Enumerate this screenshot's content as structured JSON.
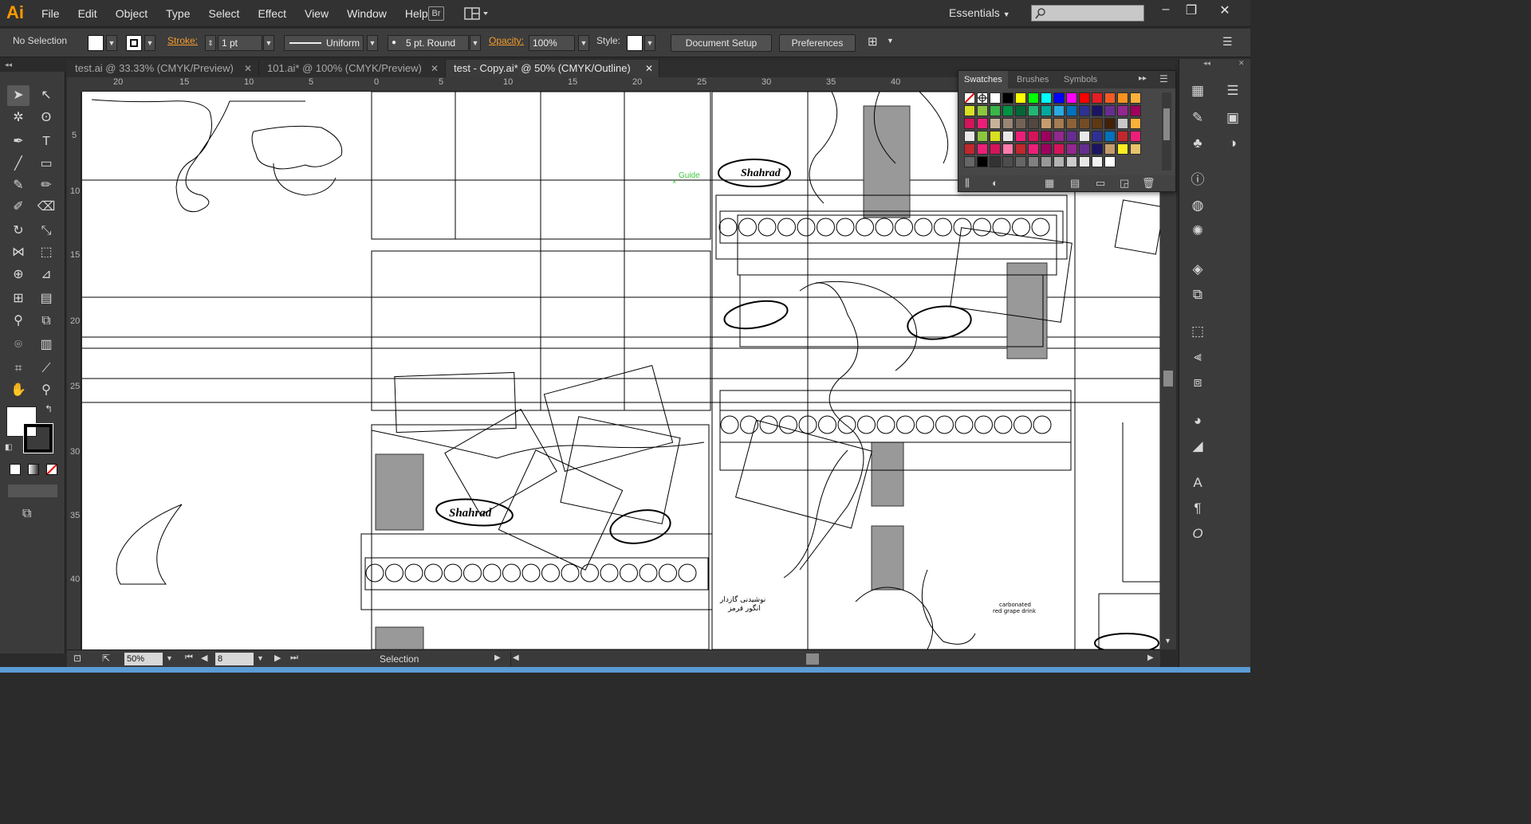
{
  "app": {
    "logo": "Ai",
    "menu": [
      "File",
      "Edit",
      "Object",
      "Type",
      "Select",
      "Effect",
      "View",
      "Window",
      "Help"
    ],
    "bridge_label": "Br",
    "workspace": "Essentials"
  },
  "control": {
    "selection": "No Selection",
    "stroke_label": "Stroke:",
    "stroke_value": "1 pt",
    "profile": "Uniform",
    "brush": "5 pt. Round",
    "opacity_label": "Opacity:",
    "opacity_value": "100%",
    "style_label": "Style:",
    "document_setup": "Document Setup",
    "preferences": "Preferences"
  },
  "tabs": [
    {
      "label": "test.ai @ 33.33% (CMYK/Preview)",
      "active": false
    },
    {
      "label": "101.ai* @ 100% (CMYK/Preview)",
      "active": false
    },
    {
      "label": "test - Copy.ai* @ 50% (CMYK/Outline)",
      "active": true
    }
  ],
  "ruler": {
    "h_labels": [
      "20",
      "15",
      "10",
      "5",
      "0",
      "5",
      "10",
      "15",
      "20",
      "25",
      "30",
      "35",
      "40"
    ],
    "v_labels": [
      "5",
      "10",
      "15",
      "20",
      "25",
      "30",
      "35",
      "40"
    ]
  },
  "canvas": {
    "guide_label": "Guide",
    "rtl_text_1": "نوشیدنی گازدار",
    "rtl_text_2": "انگور قرمز",
    "en_text_1": "carbonated",
    "en_text_2": "red grape drink",
    "logo_text": "Shahrad"
  },
  "swatches": {
    "tabs": [
      "Swatches",
      "Brushes",
      "Symbols"
    ],
    "colors": {
      "accent_orange": "#ff9a00",
      "guide_green": "#3cc83c"
    },
    "rows": [
      [
        "none",
        "reg",
        "#ffffff",
        "#000000",
        "#ffff00",
        "#00ff00",
        "#00ffff",
        "#0000ff",
        "#ff00ff",
        "#ff0000",
        "#e31e24",
        "#f15a24",
        "#f7931e",
        "#fbb03b"
      ],
      [
        "#d9e021",
        "#8cc63f",
        "#39b54a",
        "#009245",
        "#006837",
        "#22b573",
        "#00a99d",
        "#29abe2",
        "#0071bc",
        "#2e3192",
        "#1b1464",
        "#662d91",
        "#93278f",
        "#9e005d"
      ],
      [
        "#d4145a",
        "#ed1e79",
        "#c7b299",
        "#998675",
        "#736357",
        "#534741",
        "#c69c6d",
        "#a67c52",
        "#8c6239",
        "#754c24",
        "#603813",
        "#42210b",
        "#c8c8c8",
        "#fbb03b"
      ],
      [
        "#e8e8e8",
        "#8cc63f",
        "#d9e021",
        "#e8e8e8",
        "#ed1e79",
        "#d4145a",
        "#9e005d",
        "#93278f",
        "#662d91",
        "#e8e8e8",
        "#2e3192",
        "#0071bc",
        "#c1272d",
        "#ed1e79"
      ],
      [
        "#c1272d",
        "#ed1e79",
        "#d4145a",
        "#ff7bac",
        "#c1272d",
        "#ed1e79",
        "#9e005d",
        "#d4145a",
        "#93278f",
        "#662d91",
        "#1b1464",
        "#c69c6d",
        "#fcee21",
        "#e8c36a"
      ],
      [
        "#666666",
        "#000000",
        "#333333",
        "#4d4d4d",
        "#666666",
        "#808080",
        "#999999",
        "#b3b3b3",
        "#cccccc",
        "#e6e6e6",
        "#f2f2f2",
        "#ffffff"
      ]
    ]
  },
  "status": {
    "zoom": "50%",
    "page": "8",
    "tool": "Selection"
  }
}
